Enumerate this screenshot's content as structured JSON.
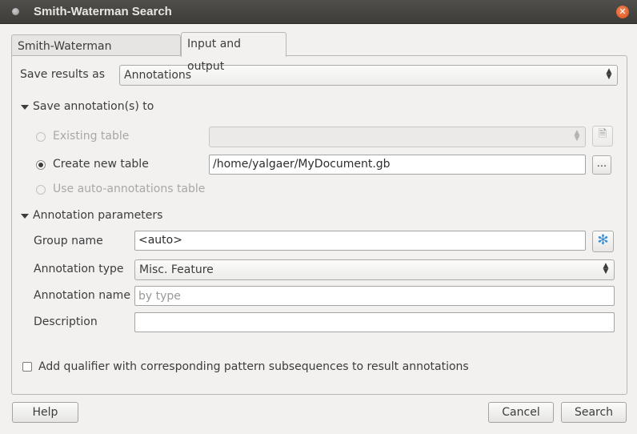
{
  "window": {
    "title": "Smith-Waterman Search"
  },
  "tabs": [
    {
      "label": "Smith-Waterman parameters"
    },
    {
      "label": "Input and output"
    }
  ],
  "save_results": {
    "label": "Save results as",
    "value": "Annotations"
  },
  "save_annotations": {
    "section_label": "Save annotation(s) to",
    "existing_table_label": "Existing table",
    "create_new_label": "Create new table",
    "new_table_path": "/home/yalgaer/MyDocument.gb",
    "browse_label": "...",
    "auto_annotations_label": "Use auto-annotations table"
  },
  "annotation_params": {
    "section_label": "Annotation parameters",
    "group_name_label": "Group name",
    "group_name_value": "<auto>",
    "type_label": "Annotation type",
    "type_value": "Misc. Feature",
    "name_label": "Annotation name",
    "name_placeholder": "by type",
    "description_label": "Description",
    "description_value": ""
  },
  "qualifier": {
    "label": "Add qualifier with corresponding pattern subsequences to result annotations"
  },
  "buttons": {
    "help": "Help",
    "cancel": "Cancel",
    "search": "Search"
  }
}
